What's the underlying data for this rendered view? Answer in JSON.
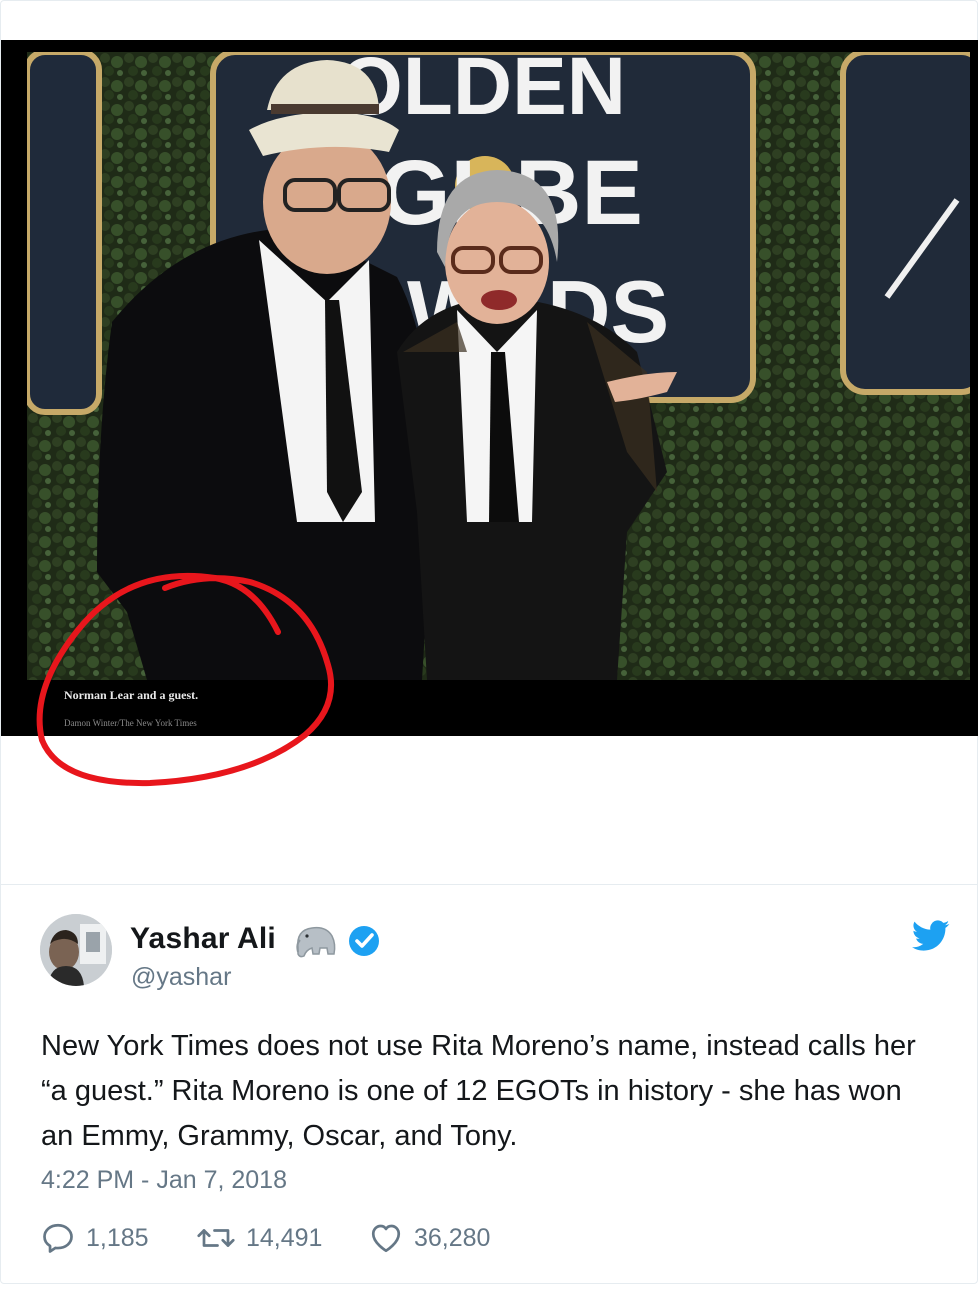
{
  "photo": {
    "caption_title": "Norman Lear and a guest.",
    "caption_credit": "Damon Winter/The New York Times",
    "backdrop_text": [
      "OLDEN",
      "GL",
      "BE",
      "W",
      "DS"
    ],
    "annotation_color": "#e8161c"
  },
  "tweet": {
    "author_name": "Yashar Ali",
    "author_handle": "@yashar",
    "name_emoji": "elephant-icon",
    "verified": true,
    "text": "New York Times does not use Rita Moreno’s name, instead calls her “a guest.” Rita Moreno is one of 12 EGOTs in history - she has won an Emmy, Grammy, Oscar, and Tony.",
    "timestamp": "4:22 PM - Jan 7, 2018",
    "replies": "1,185",
    "retweets": "14,491",
    "likes": "36,280"
  },
  "colors": {
    "twitter_blue": "#1da1f2",
    "verified_blue": "#1da1f2",
    "text_primary": "#14171a",
    "text_secondary": "#657786"
  }
}
